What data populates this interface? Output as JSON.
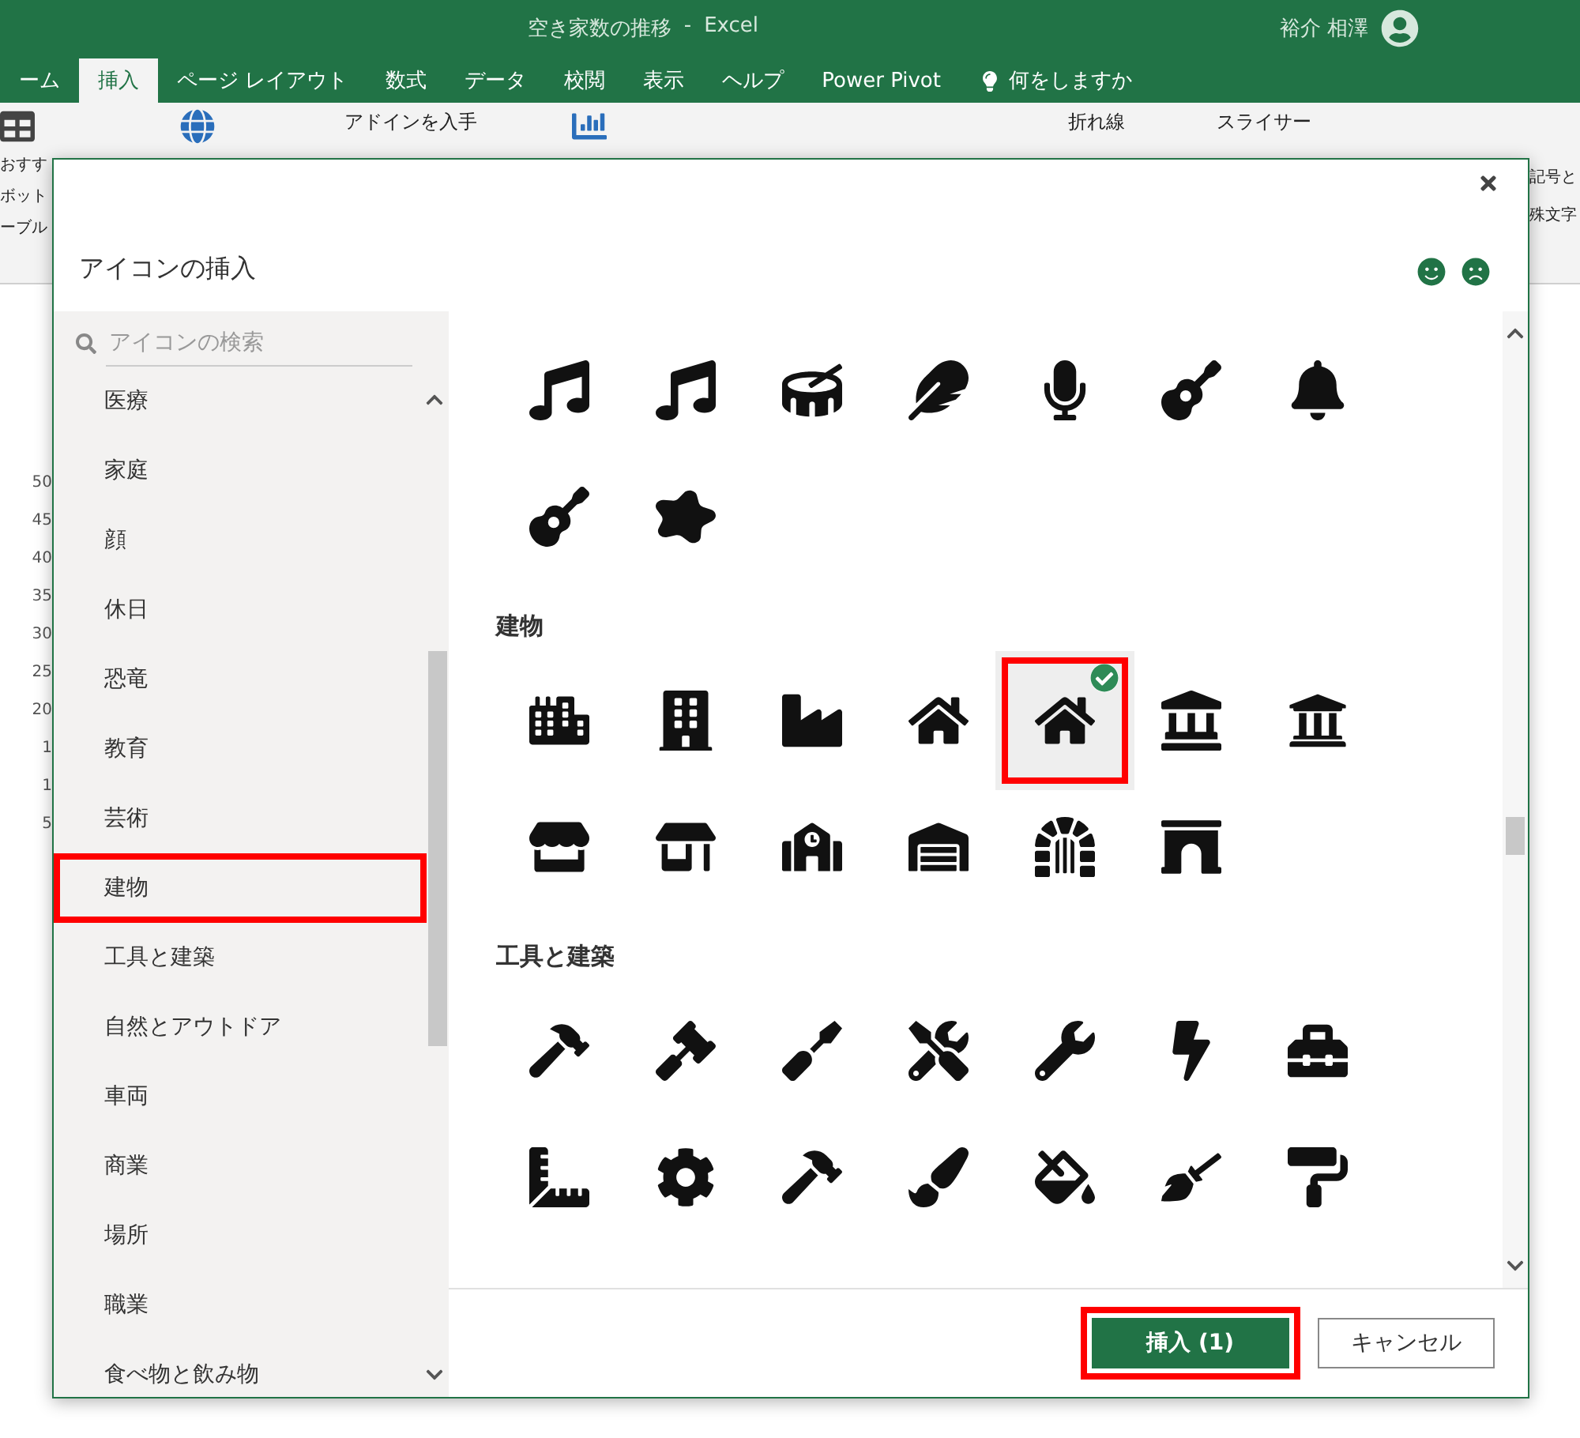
{
  "title_bar": {
    "document": "空き家数の推移",
    "app": "Excel",
    "separator": "-",
    "user": "裕介 相澤"
  },
  "ribbon_tabs": [
    {
      "label": "ーム",
      "selected": false
    },
    {
      "label": "挿入",
      "selected": true
    },
    {
      "label": "ページ レイアウト",
      "selected": false
    },
    {
      "label": "数式",
      "selected": false
    },
    {
      "label": "データ",
      "selected": false
    },
    {
      "label": "校閲",
      "selected": false
    },
    {
      "label": "表示",
      "selected": false
    },
    {
      "label": "ヘルプ",
      "selected": false
    },
    {
      "label": "Power Pivot",
      "selected": false
    }
  ],
  "tell_me": "何をしますか",
  "ribbon": {
    "left_labels": [
      "おすす",
      "ボット",
      "ーブル"
    ],
    "addins": "アドインを入手",
    "line": "折れ線",
    "slicer": "スライサー",
    "right_labels": [
      "記号と",
      "殊文字"
    ]
  },
  "axis_labels": [
    "50",
    "45",
    "40",
    "35",
    "30",
    "25",
    "20",
    "1",
    "1",
    "5"
  ],
  "dialog": {
    "title": "アイコンの挿入",
    "search": {
      "placeholder": "アイコンの検索"
    },
    "categories": [
      {
        "label": "医療",
        "selected": false
      },
      {
        "label": "家庭",
        "selected": false
      },
      {
        "label": "顔",
        "selected": false
      },
      {
        "label": "休日",
        "selected": false
      },
      {
        "label": "恐竜",
        "selected": false
      },
      {
        "label": "教育",
        "selected": false
      },
      {
        "label": "芸術",
        "selected": false
      },
      {
        "label": "建物",
        "selected": true
      },
      {
        "label": "工具と建築",
        "selected": false
      },
      {
        "label": "自然とアウトドア",
        "selected": false
      },
      {
        "label": "車両",
        "selected": false
      },
      {
        "label": "商業",
        "selected": false
      },
      {
        "label": "場所",
        "selected": false
      },
      {
        "label": "職業",
        "selected": false
      },
      {
        "label": "食べ物と飲み物",
        "selected": false
      }
    ],
    "sections": [
      {
        "icons": [
          {
            "selected": false
          },
          {
            "selected": false
          },
          {
            "selected": false
          },
          {
            "selected": false
          },
          {
            "selected": false
          },
          {
            "selected": false
          },
          {
            "selected": false
          },
          {
            "selected": false
          },
          {
            "selected": false
          }
        ]
      },
      {
        "title": "建物",
        "icons": [
          {
            "selected": false
          },
          {
            "selected": false
          },
          {
            "selected": false
          },
          {
            "selected": false
          },
          {
            "selected": true
          },
          {
            "selected": false
          },
          {
            "selected": false
          },
          {
            "selected": false
          },
          {
            "selected": false
          },
          {
            "selected": false
          },
          {
            "selected": false
          },
          {
            "selected": false
          },
          {
            "selected": false
          }
        ]
      },
      {
        "title": "工具と建築",
        "icons": [
          {
            "selected": false
          },
          {
            "selected": false
          },
          {
            "selected": false
          },
          {
            "selected": false
          },
          {
            "selected": false
          },
          {
            "selected": false
          },
          {
            "selected": false
          },
          {
            "selected": false
          },
          {
            "selected": false
          },
          {
            "selected": false
          },
          {
            "selected": false
          },
          {
            "selected": false
          },
          {
            "selected": false
          },
          {
            "selected": false
          }
        ]
      }
    ],
    "buttons": [
      {
        "label": "挿入 (1)",
        "kind": "primary",
        "highlighted": true
      },
      {
        "label": "キャンセル",
        "kind": "secondary",
        "highlighted": false
      }
    ]
  }
}
